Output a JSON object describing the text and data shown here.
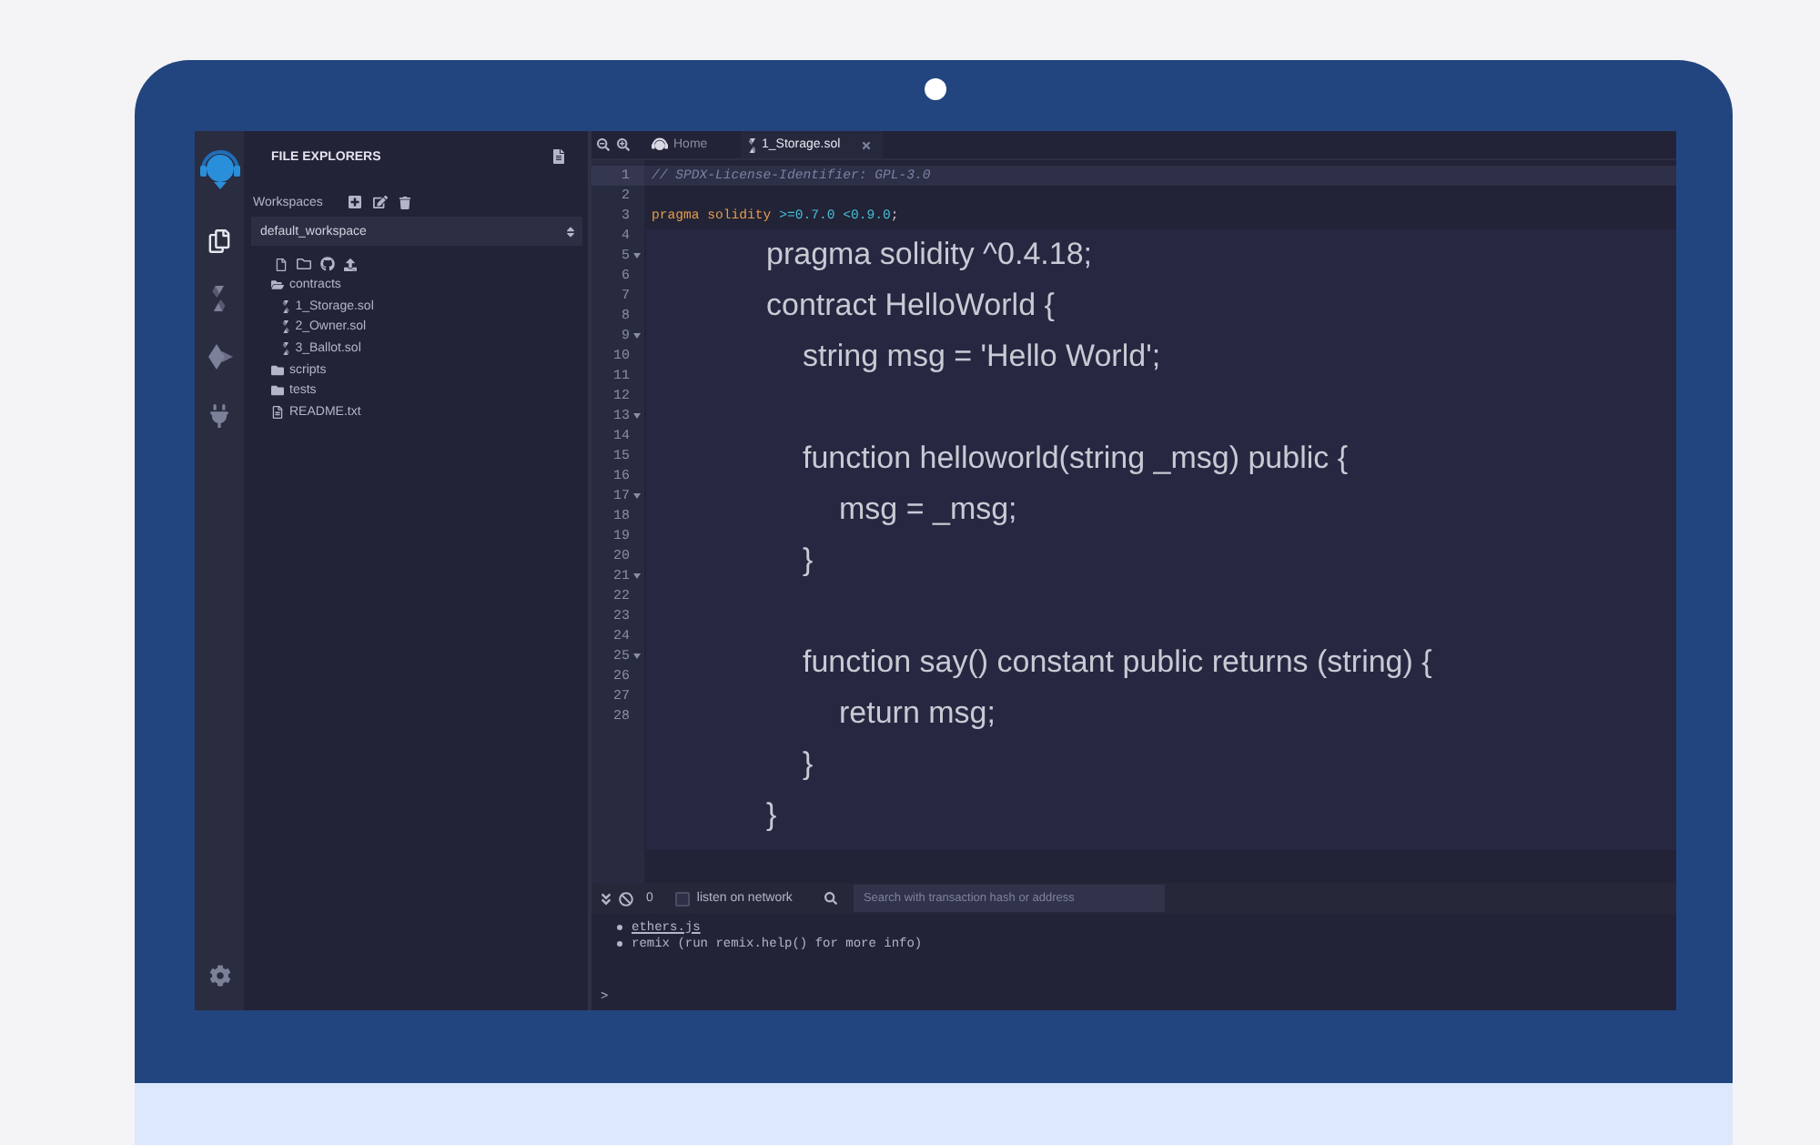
{
  "activity_bar": [
    {
      "selected": true
    },
    {
      "selected": false
    },
    {
      "selected": false
    },
    {
      "selected": false
    }
  ],
  "file_explorer": {
    "title": "FILE EXPLORERS",
    "workspaces_label": "Workspaces",
    "workspace": "default_workspace",
    "tree": [
      {
        "name": "contracts",
        "kind": "folder",
        "expanded": true,
        "children": [
          {
            "name": "1_Storage.sol",
            "kind": "solidity"
          },
          {
            "name": "2_Owner.sol",
            "kind": "solidity"
          },
          {
            "name": "3_Ballot.sol",
            "kind": "solidity"
          }
        ]
      },
      {
        "name": "scripts",
        "kind": "folder",
        "expanded": false
      },
      {
        "name": "tests",
        "kind": "folder",
        "expanded": false
      },
      {
        "name": "README.txt",
        "kind": "text"
      }
    ]
  },
  "editor": {
    "tabs": [
      {
        "label": "Home",
        "kind": "home",
        "selected": false,
        "closable": false
      },
      {
        "label": "1_Storage.sol",
        "kind": "solidity",
        "selected": true,
        "closable": true
      }
    ],
    "lines": [
      {
        "number": "1",
        "active": true,
        "foldable": false,
        "tokens": [
          {
            "kind": "comment",
            "text": "// SPDX-License-Identifier: GPL-3.0"
          }
        ]
      },
      {
        "number": "2",
        "active": false,
        "foldable": false
      },
      {
        "number": "3",
        "active": false,
        "foldable": false,
        "tokens": [
          {
            "kind": "keyword",
            "text": "pragma solidity"
          },
          {
            "kind": "version",
            "text": ">=0.7.0 <0.9.0"
          },
          {
            "kind": "punct",
            "text": ";"
          }
        ]
      },
      {
        "number": "4",
        "active": false,
        "foldable": false
      },
      {
        "number": "5",
        "active": false,
        "foldable": true
      },
      {
        "number": "6",
        "active": false,
        "foldable": false
      },
      {
        "number": "7",
        "active": false,
        "foldable": false
      },
      {
        "number": "8",
        "active": false,
        "foldable": false
      },
      {
        "number": "9",
        "active": false,
        "foldable": true
      },
      {
        "number": "10",
        "active": false,
        "foldable": false
      },
      {
        "number": "11",
        "active": false,
        "foldable": false
      },
      {
        "number": "12",
        "active": false,
        "foldable": false
      },
      {
        "number": "13",
        "active": false,
        "foldable": true
      },
      {
        "number": "14",
        "active": false,
        "foldable": false
      },
      {
        "number": "15",
        "active": false,
        "foldable": false
      },
      {
        "number": "16",
        "active": false,
        "foldable": false
      },
      {
        "number": "17",
        "active": false,
        "foldable": true
      },
      {
        "number": "18",
        "active": false,
        "foldable": false
      },
      {
        "number": "19",
        "active": false,
        "foldable": false
      },
      {
        "number": "20",
        "active": false,
        "foldable": false
      },
      {
        "number": "21",
        "active": false,
        "foldable": true
      },
      {
        "number": "22",
        "active": false,
        "foldable": false
      },
      {
        "number": "23",
        "active": false,
        "foldable": false
      },
      {
        "number": "24",
        "active": false,
        "foldable": false
      },
      {
        "number": "25",
        "active": false,
        "foldable": true
      },
      {
        "number": "26",
        "active": false,
        "foldable": false
      },
      {
        "number": "27",
        "active": false,
        "foldable": false
      },
      {
        "number": "28",
        "active": false,
        "foldable": false
      }
    ],
    "code_overlay": [
      {
        "kind": "code",
        "text": "pragma solidity ^0.4.18;"
      },
      {
        "kind": "code",
        "text": "contract HelloWorld {",
        "children": [
          {
            "kind": "code",
            "text": "string msg = 'Hello World';"
          },
          {
            "kind": "blank"
          },
          {
            "kind": "code",
            "text": "function helloworld(string _msg) public {",
            "children": [
              {
                "kind": "code",
                "text": "msg = _msg;"
              }
            ]
          },
          {
            "kind": "code",
            "text": "}"
          },
          {
            "kind": "blank"
          },
          {
            "kind": "code",
            "text": "function say() constant public returns (string) {",
            "children": [
              {
                "kind": "code",
                "text": "return msg;"
              }
            ]
          },
          {
            "kind": "code",
            "text": "}"
          }
        ]
      },
      {
        "kind": "code",
        "text": "}"
      }
    ]
  },
  "terminal": {
    "pending_count": "0",
    "listen_on_network": {
      "label": "listen on network",
      "checked": false
    },
    "search": {
      "placeholder": "Search with transaction hash or address"
    },
    "output": [
      {
        "kind": "link",
        "text": "ethers.js"
      },
      {
        "kind": "plain",
        "text": "remix (run remix.help() for more info)"
      }
    ],
    "prompt": ">"
  }
}
